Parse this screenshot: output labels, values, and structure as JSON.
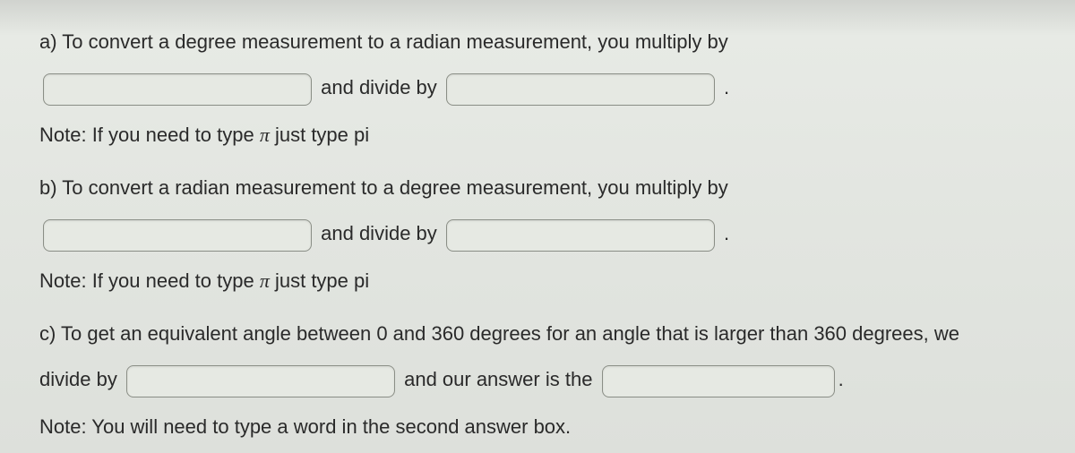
{
  "a": {
    "letter": "a)",
    "text1": "To convert a degree measurement to a radian measurement, you multiply by",
    "mid": "and divide by",
    "period": ".",
    "note_pre": "Note: If you need to type ",
    "note_pi": "π",
    "note_post": " just type pi"
  },
  "b": {
    "letter": "b)",
    "text1": "To convert a radian measurement to a degree measurement, you multiply by",
    "mid": "and divide by",
    "period": ".",
    "note_pre": "Note: If you need to type ",
    "note_pi": "π",
    "note_post": " just type pi"
  },
  "c": {
    "letter": "c)",
    "text1": "To get an equivalent angle between 0 and 360 degrees for an angle that is larger than 360 degrees, we",
    "line2_pre": "divide by",
    "mid": "and our answer is the",
    "period": ".",
    "note": "Note: You will need to type a word in the second answer box."
  },
  "inputs": {
    "a1": "",
    "a2": "",
    "b1": "",
    "b2": "",
    "c1": "",
    "c2": ""
  }
}
